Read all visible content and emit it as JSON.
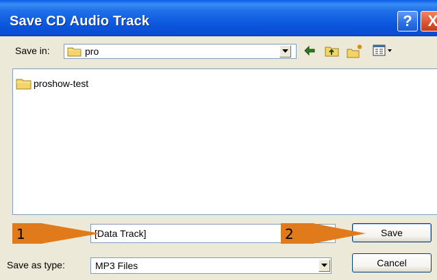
{
  "window": {
    "title": "Save CD Audio Track",
    "help_label": "?",
    "close_label": "X"
  },
  "toolbar": {
    "save_in_label": "Save in:",
    "save_in_value": "pro",
    "icons": [
      "back-arrow-icon",
      "up-folder-icon",
      "new-folder-icon",
      "view-menu-icon"
    ]
  },
  "file_list": {
    "items": [
      {
        "name": "proshow-test",
        "type": "folder"
      }
    ]
  },
  "form": {
    "file_name_value": "[Data Track]",
    "save_as_type_label": "Save as type:",
    "save_as_type_value": "MP3 Files"
  },
  "buttons": {
    "save_label": "Save",
    "cancel_label": "Cancel"
  },
  "annotations": [
    {
      "label": "1"
    },
    {
      "label": "2"
    }
  ],
  "colors": {
    "titlebar": "#0b57dd",
    "annotation": "#e07a1a",
    "folder": "#f3d36a"
  }
}
